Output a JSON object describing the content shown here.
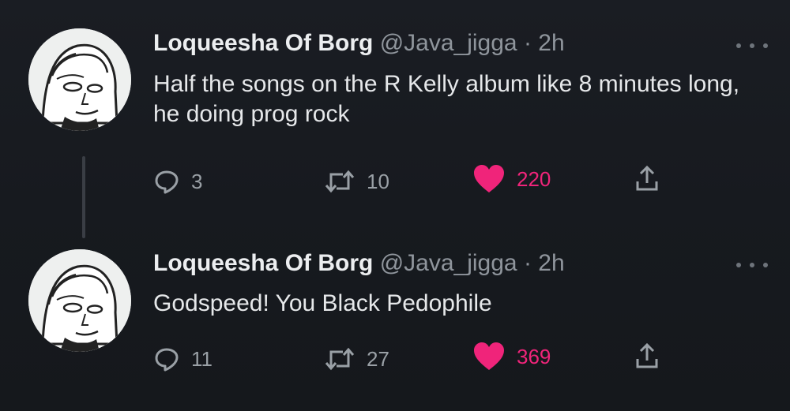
{
  "tweets": [
    {
      "author_name": "Loqueesha Of Borg",
      "handle": "@Java_jigga",
      "separator": "·",
      "time": "2h",
      "text": "Half the songs on the R Kelly album like 8 minutes long, he doing prog rock",
      "replies": "3",
      "retweets": "10",
      "likes": "220",
      "liked": true
    },
    {
      "author_name": "Loqueesha Of Borg",
      "handle": "@Java_jigga",
      "separator": "·",
      "time": "2h",
      "text": "Godspeed! You Black Pedophile",
      "replies": "11",
      "retweets": "27",
      "likes": "369",
      "liked": true
    }
  ],
  "colors": {
    "background": "#15181d",
    "like_accent": "#f0247a",
    "secondary_text": "#8f959c"
  },
  "icons": [
    "reply-icon",
    "retweet-icon",
    "like-heart-icon",
    "share-icon",
    "more-options-icon"
  ]
}
